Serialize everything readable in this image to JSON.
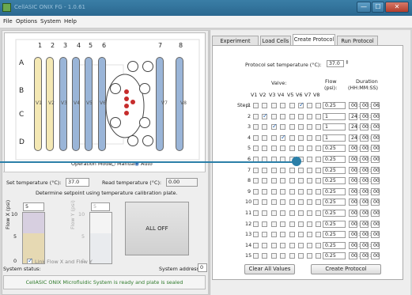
{
  "window": {
    "title": "CellASIC ONIX FG  - 1.0.61",
    "min": "—",
    "max": "☐",
    "close": "✕"
  },
  "menu": [
    "File",
    "Options",
    "System",
    "Help"
  ],
  "plate": {
    "columns": [
      "1",
      "2",
      "3",
      "4",
      "5",
      "6",
      "7",
      "8"
    ],
    "rows": [
      "A",
      "B",
      "C",
      "D"
    ],
    "valve_labels": [
      "V1",
      "V2",
      "V3",
      "V4",
      "V5",
      "V6",
      "V7",
      "V8"
    ],
    "operation_mode_label": "Operation Mode:",
    "mode_manual": "Manual",
    "mode_auto": "Auto",
    "mode_selected": "Auto"
  },
  "controls": {
    "set_temp_label": "Set temperature (°C):",
    "set_temp_value": "37.0",
    "read_temp_label": "Read temperature (°C):",
    "read_temp_value": "0.00",
    "calibration_note": "Determine setpoint using temperature calibration plate.",
    "flow_x_label": "Flow X (psi)",
    "flow_y_label": "Flow Y (psi)",
    "flow_x_value": "5",
    "flow_y_value": "5",
    "scale_top": "10",
    "scale_mid": "5",
    "scale_bottom": "0",
    "link_label": "Link Flow X and Flow Y",
    "all_off": "ALL OFF",
    "system_status_label": "System status:",
    "system_address_label": "System address:",
    "system_address_value": "0",
    "status_message": "CellASIC ONIX Microfluidic System is ready and plate is sealed"
  },
  "tabs": [
    "Experiment Design",
    "Load Cells",
    "Create Protocol",
    "Run Protocol"
  ],
  "active_tab": "Create Protocol",
  "protocol": {
    "set_temp_label": "Protocol set temperature (°C):",
    "set_temp_value": "37.0",
    "valve_header": "Valve:",
    "valves": [
      "V1",
      "V2",
      "V3",
      "V4",
      "V5",
      "V6",
      "V7",
      "V8"
    ],
    "flow_header": "Flow",
    "flow_unit": "(psi):",
    "duration_header": "Duration",
    "duration_unit": "(HH:MM:SS)",
    "step_label": "Step:",
    "steps": [
      {
        "n": "1",
        "checked": [
          6
        ],
        "flow": "0.25",
        "hh": "00",
        "mm": "00",
        "ss": "06"
      },
      {
        "n": "2",
        "checked": [
          2
        ],
        "flow": "1",
        "hh": "24",
        "mm": "00",
        "ss": "00"
      },
      {
        "n": "3",
        "checked": [
          3
        ],
        "flow": "1",
        "hh": "24",
        "mm": "00",
        "ss": "00"
      },
      {
        "n": "4",
        "checked": [
          4
        ],
        "flow": "1",
        "hh": "24",
        "mm": "00",
        "ss": "00"
      },
      {
        "n": "5",
        "checked": [],
        "flow": "0.25",
        "hh": "00",
        "mm": "00",
        "ss": "00"
      },
      {
        "n": "6",
        "checked": [],
        "flow": "0.25",
        "hh": "00",
        "mm": "00",
        "ss": "00"
      },
      {
        "n": "7",
        "checked": [],
        "flow": "0.25",
        "hh": "00",
        "mm": "00",
        "ss": "00"
      },
      {
        "n": "8",
        "checked": [],
        "flow": "0.25",
        "hh": "00",
        "mm": "00",
        "ss": "00"
      },
      {
        "n": "9",
        "checked": [],
        "flow": "0.25",
        "hh": "00",
        "mm": "00",
        "ss": "00"
      },
      {
        "n": "10",
        "checked": [],
        "flow": "0.25",
        "hh": "00",
        "mm": "00",
        "ss": "00"
      },
      {
        "n": "11",
        "checked": [],
        "flow": "0.25",
        "hh": "00",
        "mm": "00",
        "ss": "00"
      },
      {
        "n": "12",
        "checked": [],
        "flow": "0.25",
        "hh": "00",
        "mm": "00",
        "ss": "00"
      },
      {
        "n": "13",
        "checked": [],
        "flow": "0.25",
        "hh": "00",
        "mm": "00",
        "ss": "00"
      },
      {
        "n": "14",
        "checked": [],
        "flow": "0.25",
        "hh": "00",
        "mm": "00",
        "ss": "00"
      },
      {
        "n": "15",
        "checked": [],
        "flow": "0.25",
        "hh": "00",
        "mm": "00",
        "ss": "00"
      }
    ],
    "clear_all": "Clear All Values",
    "create_protocol": "Create Protocol"
  },
  "colors": {
    "titlebar": "#2b6890",
    "well_yellow": "#f4e8b4",
    "well_blue": "#9ab5d8",
    "status_text": "#2f7a2b",
    "overlay_line": "#2b7fa8"
  }
}
